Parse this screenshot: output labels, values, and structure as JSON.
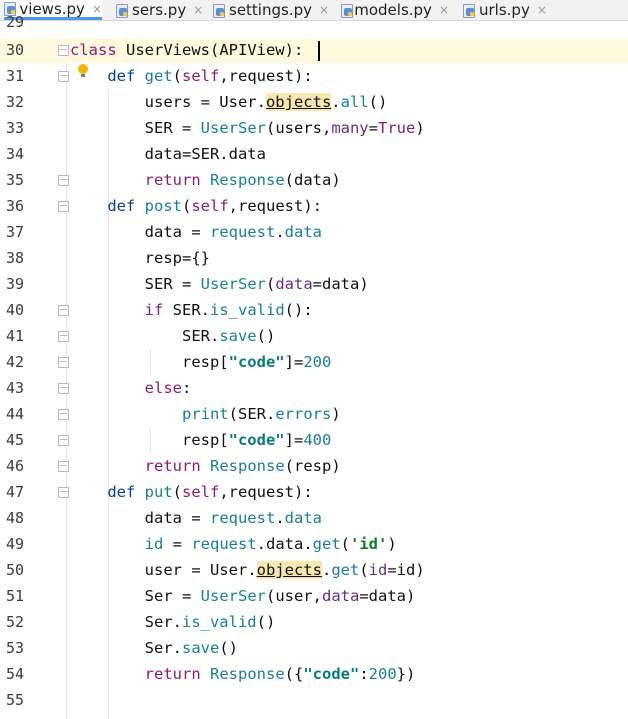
{
  "tabs": [
    {
      "label": "views.py",
      "active": true
    },
    {
      "label": "sers.py",
      "active": false
    },
    {
      "label": "settings.py",
      "active": false
    },
    {
      "label": "models.py",
      "active": false
    },
    {
      "label": "urls.py",
      "active": false
    }
  ],
  "tab_close_glyph": "×",
  "editor": {
    "first_line_partial": "29",
    "lines": [
      {
        "n": "30",
        "tokens": [
          [
            "kw2",
            "class"
          ],
          [
            "",
            " UserViews(APIView):"
          ]
        ]
      },
      {
        "n": "31",
        "tokens": [
          [
            "",
            "    "
          ],
          [
            "kw",
            "def"
          ],
          [
            "",
            " "
          ],
          [
            "fn",
            "get"
          ],
          [
            "",
            "("
          ],
          [
            "self",
            "self"
          ],
          [
            "",
            ",request):"
          ]
        ]
      },
      {
        "n": "32",
        "tokens": [
          [
            "",
            "        users = User."
          ],
          [
            "hl",
            "objects"
          ],
          [
            "",
            "."
          ],
          [
            "fn",
            "all"
          ],
          [
            "",
            "()"
          ]
        ]
      },
      {
        "n": "33",
        "tokens": [
          [
            "",
            "        SER = "
          ],
          [
            "fn",
            "UserSer"
          ],
          [
            "",
            "(users,"
          ],
          [
            "param",
            "many"
          ],
          [
            "",
            "="
          ],
          [
            "kw2",
            "True"
          ],
          [
            "",
            ")"
          ]
        ]
      },
      {
        "n": "34",
        "tokens": [
          [
            "",
            "        data=SER.data"
          ]
        ]
      },
      {
        "n": "35",
        "tokens": [
          [
            "",
            "        "
          ],
          [
            "kw2",
            "return"
          ],
          [
            "",
            " "
          ],
          [
            "fn",
            "Response"
          ],
          [
            "",
            "(data)"
          ]
        ]
      },
      {
        "n": "36",
        "tokens": [
          [
            "",
            "    "
          ],
          [
            "kw",
            "def"
          ],
          [
            "",
            " "
          ],
          [
            "fn",
            "post"
          ],
          [
            "",
            "("
          ],
          [
            "self",
            "self"
          ],
          [
            "",
            ",request):"
          ]
        ]
      },
      {
        "n": "37",
        "tokens": [
          [
            "",
            "        data = "
          ],
          [
            "fn",
            "request"
          ],
          [
            "",
            "."
          ],
          [
            "fn",
            "data"
          ]
        ]
      },
      {
        "n": "38",
        "tokens": [
          [
            "",
            "        resp={}"
          ]
        ]
      },
      {
        "n": "39",
        "tokens": [
          [
            "",
            "        SER = "
          ],
          [
            "fn",
            "UserSer"
          ],
          [
            "",
            "("
          ],
          [
            "param",
            "data"
          ],
          [
            "",
            "=data)"
          ]
        ]
      },
      {
        "n": "40",
        "tokens": [
          [
            "",
            "        "
          ],
          [
            "kw2",
            "if"
          ],
          [
            "",
            " SER."
          ],
          [
            "fn",
            "is_valid"
          ],
          [
            "",
            "():"
          ]
        ]
      },
      {
        "n": "41",
        "tokens": [
          [
            "",
            "            SER."
          ],
          [
            "fn",
            "save"
          ],
          [
            "",
            "()"
          ]
        ]
      },
      {
        "n": "42",
        "tokens": [
          [
            "",
            "            resp["
          ],
          [
            "str",
            "\"code\""
          ],
          [
            "",
            "]="
          ],
          [
            "num",
            "200"
          ]
        ]
      },
      {
        "n": "43",
        "tokens": [
          [
            "",
            "        "
          ],
          [
            "kw2",
            "else"
          ],
          [
            "",
            ":"
          ]
        ]
      },
      {
        "n": "44",
        "tokens": [
          [
            "",
            "            "
          ],
          [
            "fn",
            "print"
          ],
          [
            "",
            "(SER."
          ],
          [
            "fn",
            "errors"
          ],
          [
            "",
            ")"
          ]
        ]
      },
      {
        "n": "45",
        "tokens": [
          [
            "",
            "            resp["
          ],
          [
            "str",
            "\"code\""
          ],
          [
            "",
            "]="
          ],
          [
            "num",
            "400"
          ]
        ]
      },
      {
        "n": "46",
        "tokens": [
          [
            "",
            "        "
          ],
          [
            "kw2",
            "return"
          ],
          [
            "",
            " "
          ],
          [
            "fn",
            "Response"
          ],
          [
            "",
            "(resp)"
          ]
        ]
      },
      {
        "n": "47",
        "tokens": [
          [
            "",
            "    "
          ],
          [
            "kw",
            "def"
          ],
          [
            "",
            " "
          ],
          [
            "fn",
            "put"
          ],
          [
            "",
            "("
          ],
          [
            "self",
            "self"
          ],
          [
            "",
            ",request):"
          ]
        ]
      },
      {
        "n": "48",
        "tokens": [
          [
            "",
            "        data = "
          ],
          [
            "fn",
            "request"
          ],
          [
            "",
            "."
          ],
          [
            "fn",
            "data"
          ]
        ]
      },
      {
        "n": "49",
        "tokens": [
          [
            "",
            "        "
          ],
          [
            "fn",
            "id"
          ],
          [
            "",
            " = "
          ],
          [
            "fn",
            "request"
          ],
          [
            "",
            ".data."
          ],
          [
            "fn",
            "get"
          ],
          [
            "",
            "("
          ],
          [
            "str2",
            "'id'"
          ],
          [
            "",
            ")"
          ]
        ]
      },
      {
        "n": "50",
        "tokens": [
          [
            "",
            "        user = User."
          ],
          [
            "hl",
            "objects"
          ],
          [
            "",
            "."
          ],
          [
            "fn",
            "get"
          ],
          [
            "",
            "("
          ],
          [
            "param",
            "id"
          ],
          [
            "",
            "=id)"
          ]
        ]
      },
      {
        "n": "51",
        "tokens": [
          [
            "",
            "        Ser = "
          ],
          [
            "fn",
            "UserSer"
          ],
          [
            "",
            "(user,"
          ],
          [
            "param",
            "data"
          ],
          [
            "",
            "=data)"
          ]
        ]
      },
      {
        "n": "52",
        "tokens": [
          [
            "",
            "        Ser."
          ],
          [
            "fn",
            "is_valid"
          ],
          [
            "",
            "()"
          ]
        ]
      },
      {
        "n": "53",
        "tokens": [
          [
            "",
            "        Ser."
          ],
          [
            "fn",
            "save"
          ],
          [
            "",
            "()"
          ]
        ]
      },
      {
        "n": "54",
        "tokens": [
          [
            "",
            "        "
          ],
          [
            "kw2",
            "return"
          ],
          [
            "",
            " "
          ],
          [
            "fn",
            "Response"
          ],
          [
            "",
            "({"
          ],
          [
            "str",
            "\"code\""
          ],
          [
            "",
            ":"
          ],
          [
            "num",
            "200"
          ],
          [
            "",
            "})"
          ]
        ]
      },
      {
        "n": "55",
        "tokens": [
          [
            "",
            ""
          ]
        ]
      }
    ]
  }
}
